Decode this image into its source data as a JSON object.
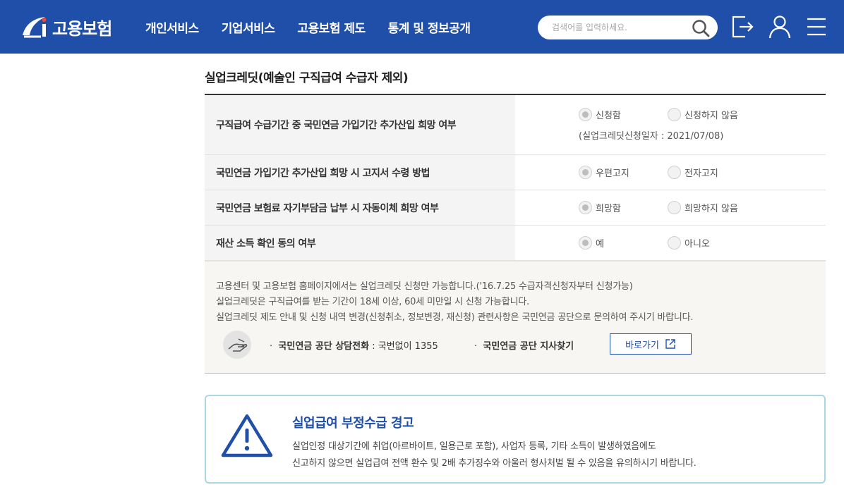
{
  "header": {
    "logo_text": "고용보험",
    "nav": [
      "개인서비스",
      "기업서비스",
      "고용보험 제도",
      "통계 및 정보공개"
    ],
    "search_placeholder": "검색어를 입력하세요."
  },
  "section": {
    "title": "실업크레딧(예술인 구직급여 수급자 제외)"
  },
  "table": {
    "rows": [
      {
        "label": "구직급여 수급기간 중 국민연금 가입기간 추가산입 희망 여부",
        "options": [
          "신청함",
          "신청하지 않음"
        ],
        "selected": "신청함",
        "note": "(실업크레딧신청일자 : 2021/07/08)"
      },
      {
        "label": "국민연금 가입기간 추가산입 희망 시 고지서 수령 방법",
        "options": [
          "우편고지",
          "전자고지"
        ],
        "selected": "우편고지"
      },
      {
        "label": "국민연금 보험료 자기부담금 납부 시 자동이체 희망 여부",
        "options": [
          "희망함",
          "희망하지 않음"
        ],
        "selected": "희망함"
      },
      {
        "label": "재산 소득 확인 동의 여부",
        "options": [
          "예",
          "아니오"
        ],
        "selected": "예"
      }
    ]
  },
  "info": {
    "lines": [
      "고용센터 및 고용보험 홈페이지에서는 실업크레딧 신청만 가능합니다.('16.7.25 수급자격신청자부터 신청가능)",
      "실업크레딧은 구직급여를 받는 기간이 18세 이상, 60세 미만일 시 신청 가능합니다.",
      "실업크레딧 제도 안내 및 신청 내역 변경(신청취소, 정보변경, 재신청) 관련사항은 국민연금 공단으로 문의하여 주시기 바랍니다."
    ],
    "phone_label": "국민연금 공단 상담전화",
    "phone_value": " : 국번없이 1355",
    "branch_label": "국민연금 공단 지사찾기",
    "goto_button": "바로가기"
  },
  "warning": {
    "title": "실업급여 부정수급 경고",
    "lines": [
      "실업인정 대상기간에 취업(아르바이트, 일용근로 포함), 사업자 등록, 기타 소득이 발생하였음에도",
      "신고하지 않으면 실업급여 전액 환수 및 2배 추가징수와 아울러 형사처벌 될 수 있음을 유의하시기 바랍니다."
    ]
  },
  "icons": [
    "logo-icon",
    "search-icon",
    "logout-icon",
    "user-icon",
    "menu-icon",
    "hand-icon",
    "external-link-icon",
    "warning-icon"
  ],
  "colors": {
    "header": "#1f4fa8",
    "accent": "#1f4fa8",
    "warning_border": "#a9d6e5"
  }
}
